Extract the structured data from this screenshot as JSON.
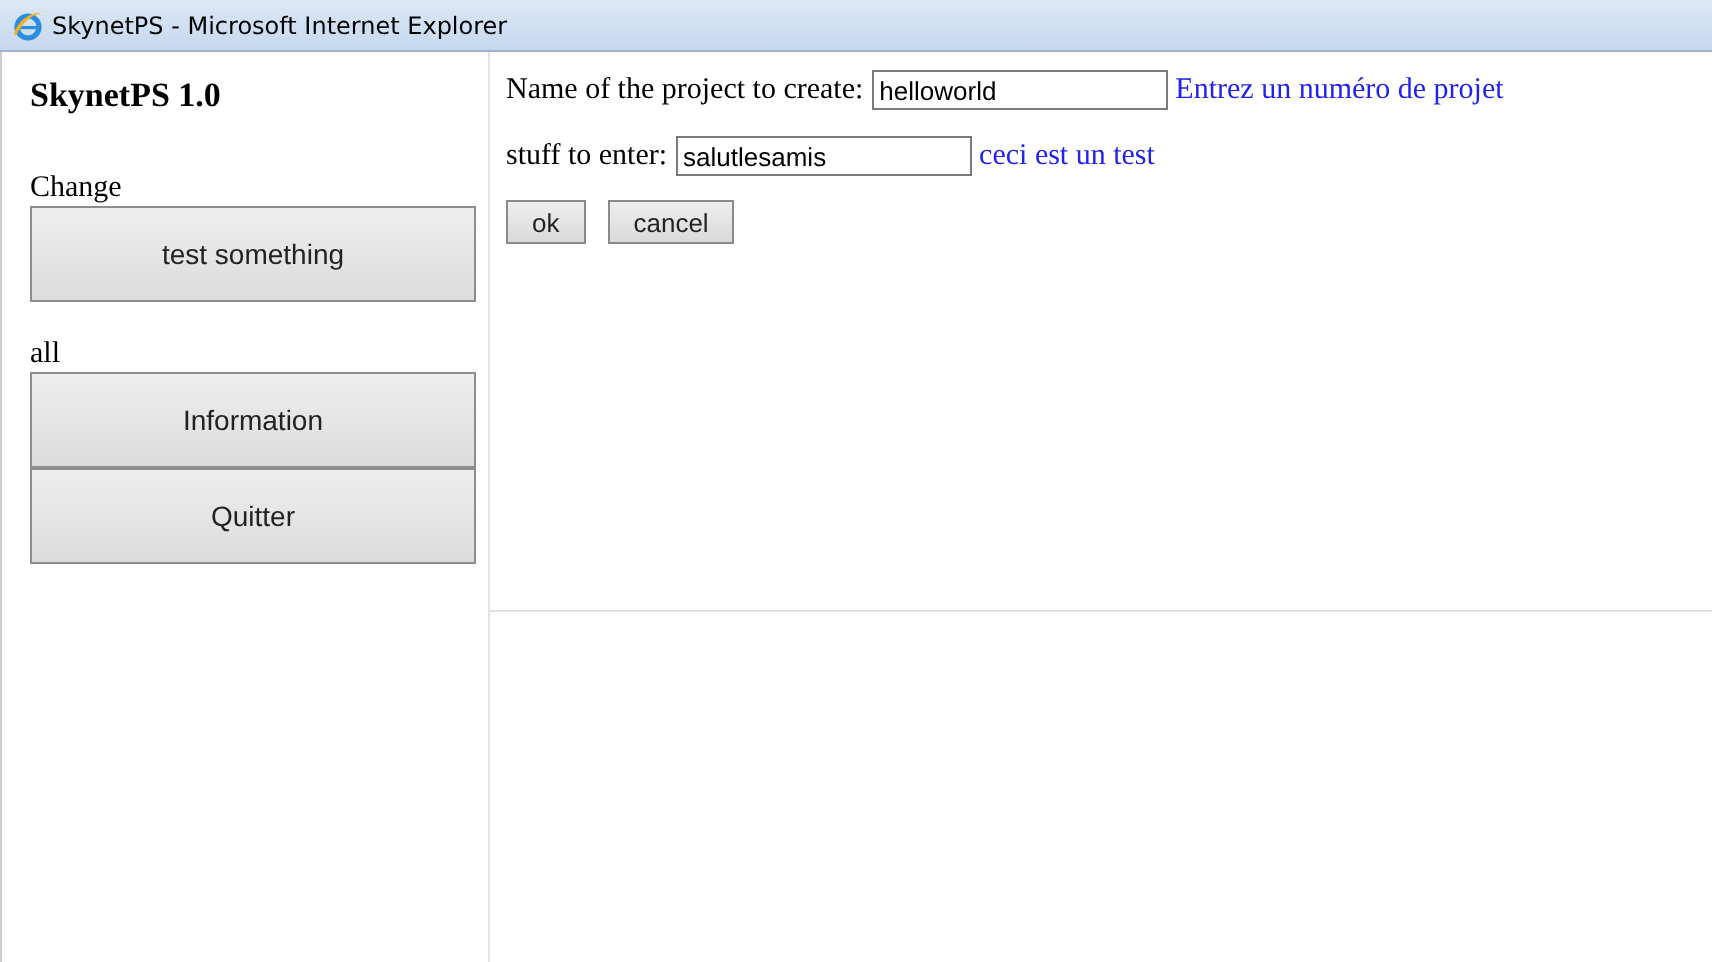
{
  "window": {
    "title": "SkynetPS - Microsoft Internet Explorer"
  },
  "sidebar": {
    "title": "SkynetPS 1.0",
    "groups": [
      {
        "label": "Change",
        "buttons": [
          "test something"
        ]
      },
      {
        "label": "all",
        "buttons": [
          "Information",
          "Quitter"
        ]
      }
    ]
  },
  "form": {
    "fields": [
      {
        "label": "Name of the project to create:",
        "value": "helloworld",
        "hint": "Entrez un numéro de projet"
      },
      {
        "label": "stuff to enter:",
        "value": "salutlesamis",
        "hint": "ceci est un test"
      }
    ],
    "buttons": [
      "ok",
      "cancel"
    ]
  }
}
